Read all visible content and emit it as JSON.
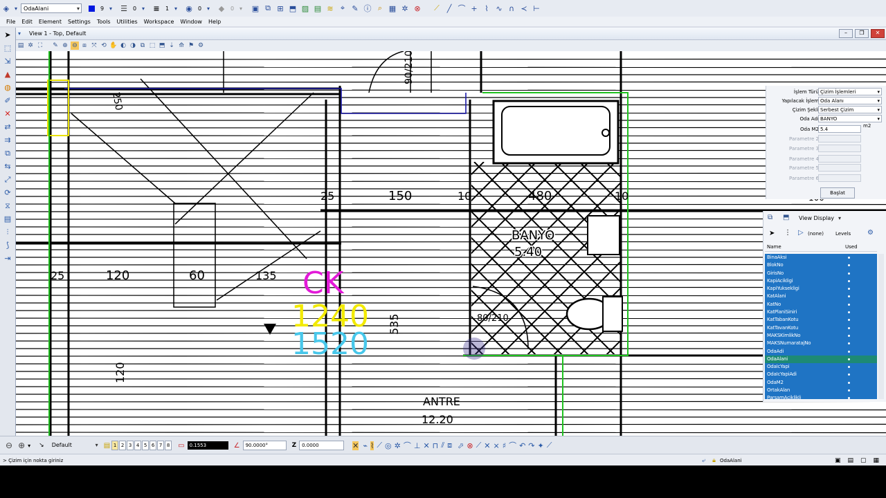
{
  "toolbar": {
    "active_level": "OdaAlani",
    "color_index": "9",
    "line_style": "0",
    "line_weight": "1",
    "transparency": "0",
    "priority": "0"
  },
  "menu": [
    "File",
    "Edit",
    "Element",
    "Settings",
    "Tools",
    "Utilities",
    "Workspace",
    "Window",
    "Help"
  ],
  "view": {
    "title": "View 1 - Top, Default"
  },
  "drawing": {
    "dims": {
      "d250": "250",
      "d90_210": "90/210",
      "d150": "150",
      "d25": "25",
      "d10": "10",
      "d480": "480",
      "d10b": "10",
      "d120": "120",
      "d60": "60",
      "d135": "135",
      "d535": "535",
      "d80_210": "80/210",
      "d120b": "120",
      "d25b": "25"
    },
    "room_banyo": "BANYO",
    "room_banyo_area": "5.40",
    "room_antre": "ANTRE",
    "room_antre_area": "12.20",
    "ck": "CK",
    "n1240": "1240",
    "n1520": "1520",
    "d100": "100"
  },
  "tool_panel": {
    "islem_turu_label": "İşlem Türü",
    "islem_turu": "Çizim İşlemleri",
    "yapilacak_label": "Yapılacak İşlem",
    "yapilacak": "Oda Alanı",
    "cizim_sekli_label": "Çizim Şekli",
    "cizim_sekli": "Serbest Çizim",
    "oda_adi_label": "Oda Adı",
    "oda_adi": "BANYO",
    "oda_m2_label": "Oda M2",
    "oda_m2": "5.4",
    "unit": "m2",
    "params": [
      "Parametre 2",
      "Parametre 3",
      "Parametre 4",
      "Parametre 5",
      "Parametre 6"
    ],
    "start_button": "Başlat"
  },
  "level_panel": {
    "display_mode": "View Display",
    "filter": "(none)",
    "levels_label": "Levels",
    "col_name": "Name",
    "col_used": "Used",
    "levels": [
      "BinaAksi",
      "BlokNo",
      "GirisNo",
      "KapiAcikligi",
      "KapiYuksekligi",
      "KatAlani",
      "KatNo",
      "KatPlaniSiniri",
      "KatTabanKotu",
      "KatTavanKotu",
      "MAKSKimlikNo",
      "MAKSNumaratajNo",
      "OdaAdi",
      "OdaAlani",
      "OdaIcYapi",
      "OdaIcYapiAdi",
      "OdaM2",
      "OrtakAlan",
      "ParsamAciklikli"
    ],
    "selected": "OdaAlani"
  },
  "bottom": {
    "color_table": "Default",
    "views": [
      "1",
      "2",
      "3",
      "4",
      "5",
      "6",
      "7",
      "8"
    ],
    "coord_x": "0.1553",
    "angle": "90.0000°",
    "z_label": "Z",
    "z_value": "0.0000"
  },
  "status": {
    "prompt": "> Çizim için nokta giriniz",
    "level": "OdaAlani"
  }
}
